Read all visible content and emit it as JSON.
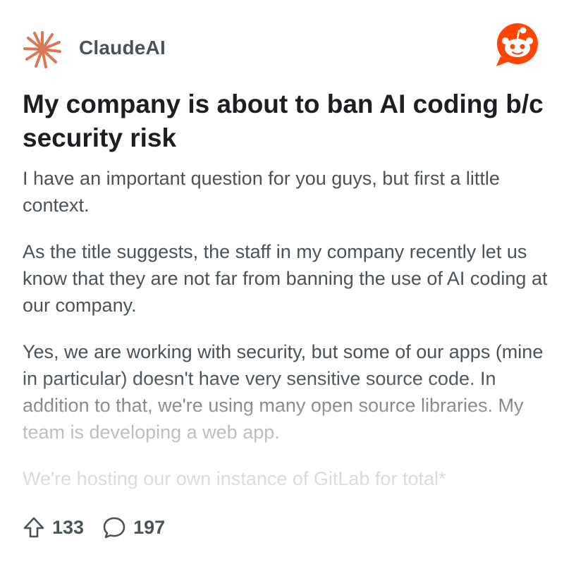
{
  "header": {
    "subreddit_name": "ClaudeAI",
    "sub_icon": "claude-sunburst-icon",
    "app_icon": "reddit-snoo-icon",
    "accent": "#ff4500"
  },
  "post": {
    "title": "My company is about to ban AI coding b/c security risk",
    "paragraphs": [
      "I have an important question for you guys, but first a little context.",
      "As the title suggests, the staff in my company recently let us know that they are not far from banning the use of AI coding at our company.",
      "Yes, we are working with security, but some of our apps (mine in particular) doesn't have very sensitive source code. In addition to that, we're using many open source libraries. My team is developing a web app.",
      "We're hosting our own instance of GitLab for total*"
    ]
  },
  "footer": {
    "upvotes": "133",
    "comments": "197",
    "upvote_icon": "upvote-arrow-icon",
    "comment_icon": "comment-bubble-icon"
  }
}
